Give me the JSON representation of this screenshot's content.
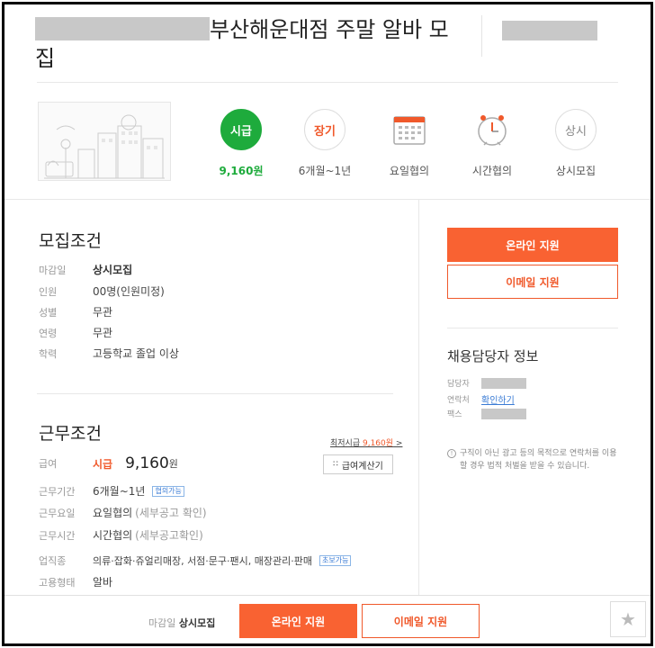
{
  "title": {
    "text": "부산해운대점 주말 알바 모집"
  },
  "summary": {
    "wage": {
      "badge": "시급",
      "value": "9,160원"
    },
    "period": {
      "badge": "장기",
      "value": "6개월~1년"
    },
    "days": {
      "icon": "calendar-icon",
      "value": "요일협의"
    },
    "hours": {
      "icon": "clock-icon",
      "value": "시간협의"
    },
    "recruit": {
      "badge": "상시",
      "value": "상시모집"
    }
  },
  "recruit_conditions": {
    "heading": "모집조건",
    "rows": [
      {
        "key": "마감일",
        "value": "상시모집"
      },
      {
        "key": "인원",
        "value": "00명(인원미정)"
      },
      {
        "key": "성별",
        "value": "무관"
      },
      {
        "key": "연령",
        "value": "무관"
      },
      {
        "key": "학력",
        "value": "고등학교 졸업 이상"
      }
    ]
  },
  "work_conditions": {
    "heading": "근무조건",
    "min_wage_prefix": "최저시급 ",
    "min_wage_value": "9,160원",
    "min_wage_suffix": " >",
    "calc_button": "급여계산기",
    "wage_key": "급여",
    "wage_type": "시급",
    "wage_value": "9,160",
    "wage_unit": "원",
    "period_key": "근무기간",
    "period_value": "6개월~1년",
    "period_badge": "협의가능",
    "days_key": "근무요일",
    "days_value": "요일협의",
    "days_note": "(세부공고 확인)",
    "hours_key": "근무시간",
    "hours_value": "시간협의",
    "hours_note": "(세부공고확인)",
    "industry_key": "업직종",
    "industry_value": "의류·잡화·쥬얼리매장, 서점·문구·팬시, 매장관리·판매",
    "industry_badge": "초보가능",
    "type_key": "고용형태",
    "type_value": "알바"
  },
  "apply": {
    "online": "온라인 지원",
    "email": "이메일 지원"
  },
  "contact": {
    "heading": "채용담당자 정보",
    "manager_key": "담당자",
    "phone_key": "연락처",
    "phone_link": "확인하기",
    "fax_key": "팩스"
  },
  "notice": "구직이 아닌 광고 등의 목적으로 연락처를 이용할 경우 법적 처벌을 받을 수 있습니다.",
  "bottom_bar": {
    "deadline_key": "마감일",
    "deadline_value": "상시모집",
    "online": "온라인 지원",
    "email": "이메일 지원"
  },
  "colors": {
    "accent": "#f96232",
    "green": "#1eab3c",
    "link": "#3a7bd5"
  }
}
